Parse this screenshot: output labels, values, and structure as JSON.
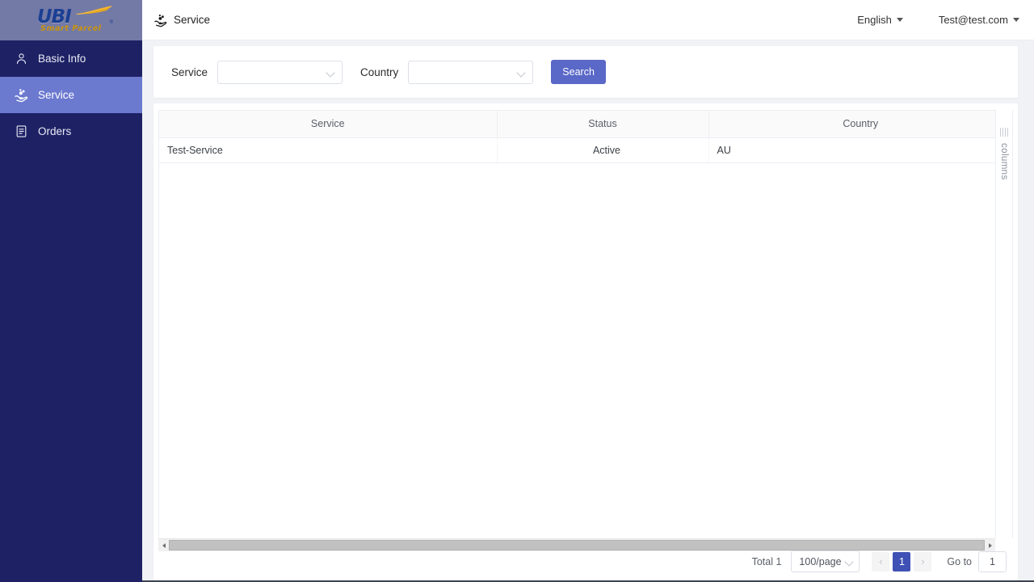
{
  "brand": {
    "logo_text": "UBI",
    "logo_registered": "®",
    "tagline": "Smart Parcel",
    "logo_color": "#1b3f93",
    "tagline_color": "#c8940f",
    "logo_bg": "#747aa6"
  },
  "sidebar": {
    "bg_color": "#1e2265",
    "active_color": "#6b79cf",
    "items": [
      {
        "label": "Basic Info",
        "icon": "user-icon",
        "active": false
      },
      {
        "label": "Service",
        "icon": "service-hand-icon",
        "active": true
      },
      {
        "label": "Orders",
        "icon": "document-list-icon",
        "active": false
      }
    ]
  },
  "topbar": {
    "breadcrumb": "Service",
    "breadcrumb_icon": "service-hand-icon",
    "language": "English",
    "account": "Test@test.com"
  },
  "filters": {
    "service": {
      "label": "Service",
      "value": "",
      "placeholder": ""
    },
    "country": {
      "label": "Country",
      "value": "",
      "placeholder": ""
    },
    "search_label": "Search",
    "search_color": "#5a68c8"
  },
  "table": {
    "columns": [
      "Service",
      "Status",
      "Country"
    ],
    "rows": [
      {
        "service": "Test-Service",
        "status": "Active",
        "country": "AU"
      }
    ],
    "status_active_color": "#67c23a",
    "columns_drawer_label": "columns"
  },
  "pagination": {
    "total_label": "Total 1",
    "page_size": "100/page",
    "prev_icon": "chevron-left-icon",
    "next_icon": "chevron-right-icon",
    "current_page": "1",
    "goto_label": "Go to",
    "goto_value": "1",
    "active_color": "#3f51b5"
  }
}
